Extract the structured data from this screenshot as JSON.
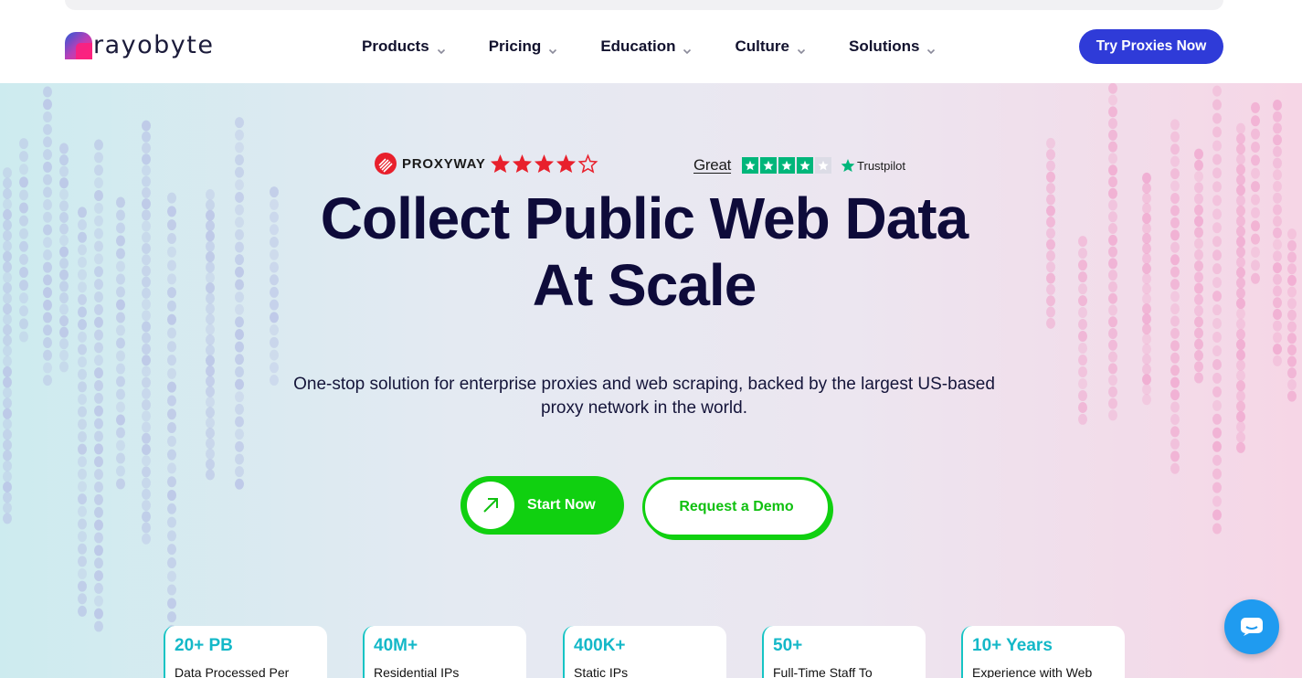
{
  "brand": {
    "name": "rayobyte"
  },
  "nav": {
    "items": [
      {
        "label": "Products"
      },
      {
        "label": "Pricing"
      },
      {
        "label": "Education"
      },
      {
        "label": "Culture"
      },
      {
        "label": "Solutions"
      }
    ],
    "cta": "Try Proxies Now"
  },
  "ratings": {
    "proxyway": {
      "name": "PROXYWAY",
      "stars": 4,
      "max": 5
    },
    "trustpilot": {
      "verdict": "Great",
      "stars": 4.5,
      "max": 5,
      "name": "Trustpilot"
    }
  },
  "hero": {
    "title_line1": "Collect Public Web Data",
    "title_line2": "At Scale",
    "subtitle": "One-stop solution for enterprise proxies and web scraping, backed by the largest US-based proxy network in the world.",
    "primary_cta": "Start Now",
    "secondary_cta": "Request a Demo"
  },
  "stats": [
    {
      "value": "20+ PB",
      "label": "Data Processed Per"
    },
    {
      "value": "40M+",
      "label": "Residential IPs"
    },
    {
      "value": "400K+",
      "label": "Static IPs"
    },
    {
      "value": "50+",
      "label": "Full-Time Staff To"
    },
    {
      "value": "10+ Years",
      "label": "Experience with Web"
    }
  ],
  "colors": {
    "primary_blue": "#2f3bd8",
    "green": "#10d010",
    "teal": "#14b8c8",
    "navy": "#0e0b3a",
    "chat_blue": "#1f9bf0"
  },
  "icons": {
    "chevron": "chevron-down-icon",
    "arrow": "arrow-up-right-icon",
    "chat": "chat-icon"
  }
}
